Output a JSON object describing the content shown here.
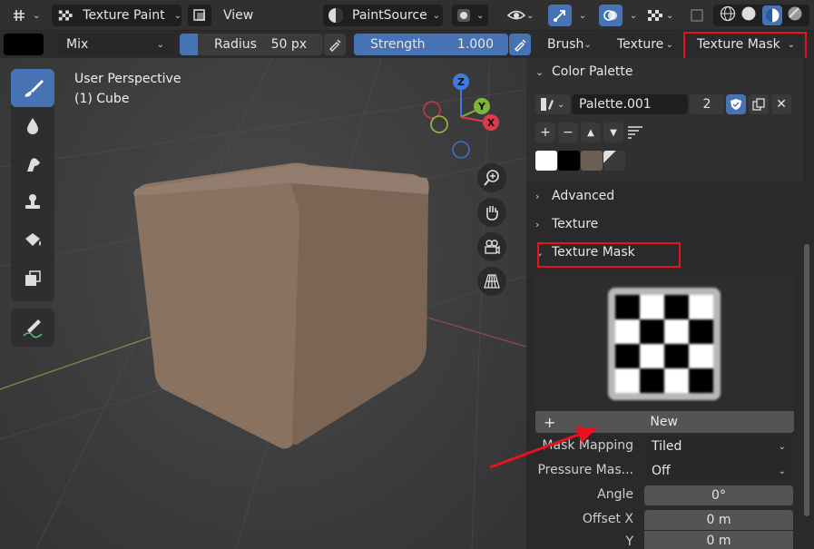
{
  "header": {
    "mode_label": "Texture Paint",
    "view_label": "View",
    "paint_source_label": "PaintSource"
  },
  "tool_settings": {
    "blend_mode": "Mix",
    "radius_label": "Radius",
    "radius_value": "50 px",
    "strength_label": "Strength",
    "strength_value": "1.000",
    "brush_menu": "Brush",
    "texture_menu": "Texture",
    "texture_mask_menu": "Texture Mask"
  },
  "viewport": {
    "perspective_label": "User Perspective",
    "object_label": "(1) Cube",
    "gizmo": {
      "z": "Z",
      "y": "Y",
      "x": "X"
    }
  },
  "panel": {
    "color_palette": {
      "title": "Color Palette",
      "palette_name": "Palette.001",
      "user_count": "2",
      "swatches": [
        "#ffffff",
        "#000000",
        "#6b5e52",
        "#3a3a3a"
      ]
    },
    "advanced_title": "Advanced",
    "texture_title": "Texture",
    "texture_mask": {
      "title": "Texture Mask",
      "new_button": "New",
      "mask_mapping_label": "Mask Mapping",
      "mask_mapping_value": "Tiled",
      "pressure_label": "Pressure Mas...",
      "pressure_value": "Off",
      "angle_label": "Angle",
      "angle_value": "0°",
      "offset_x_label": "Offset X",
      "offset_x_value": "0 m",
      "offset_y_label": "Y",
      "offset_y_value": "0 m"
    }
  },
  "colors": {
    "accent": "#4772b3",
    "highlight": "#e8121c",
    "cube": "#86705f"
  }
}
